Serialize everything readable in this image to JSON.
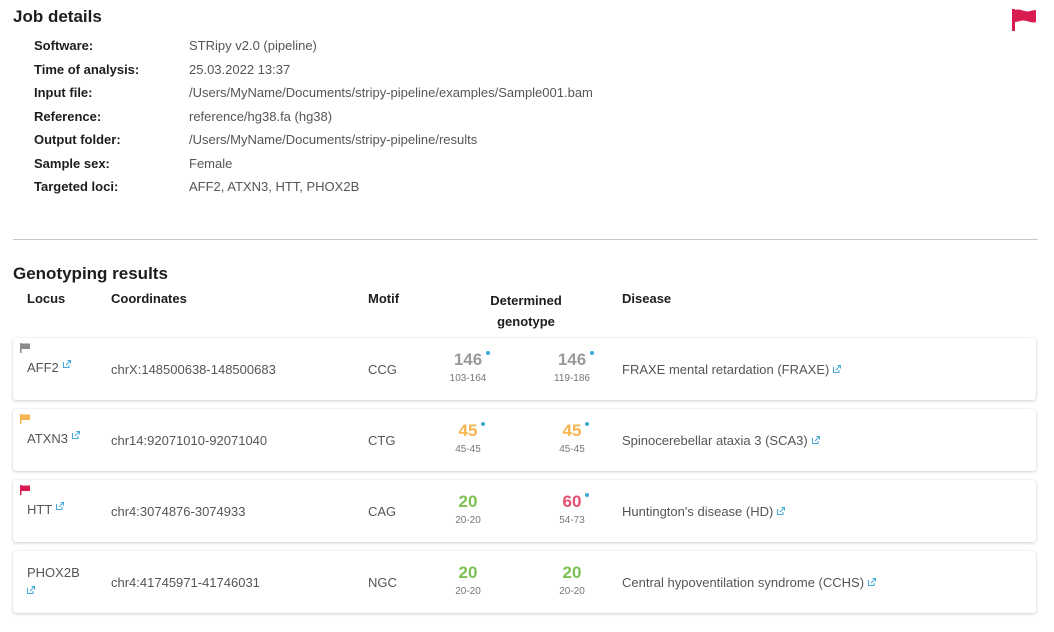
{
  "job_details": {
    "title": "Job details",
    "rows": [
      {
        "label": "Software:",
        "value": "STRipy v2.0 (pipeline)"
      },
      {
        "label": "Time of analysis:",
        "value": "25.03.2022 13:37"
      },
      {
        "label": "Input file:",
        "value": "/Users/MyName/Documents/stripy-pipeline/examples/Sample001.bam"
      },
      {
        "label": "Reference:",
        "value": "reference/hg38.fa (hg38)"
      },
      {
        "label": "Output folder:",
        "value": "/Users/MyName/Documents/stripy-pipeline/results"
      },
      {
        "label": "Sample sex:",
        "value": "Female"
      },
      {
        "label": "Targeted loci:",
        "value": "AFF2, ATXN3, HTT, PHOX2B"
      }
    ]
  },
  "genotyping": {
    "title": "Genotyping results",
    "headers": {
      "locus": "Locus",
      "coordinates": "Coordinates",
      "motif": "Motif",
      "genotype_line1": "Determined",
      "genotype_line2": "genotype",
      "disease": "Disease"
    },
    "rows": [
      {
        "locus": "AFF2",
        "coordinates": "chrX:148500638-148500683",
        "motif": "CCG",
        "allele1": "146",
        "range1": "103-164",
        "allele2": "146",
        "range2": "119-186",
        "disease": "FRAXE mental retardation (FRAXE)"
      },
      {
        "locus": "ATXN3",
        "coordinates": "chr14:92071010-92071040",
        "motif": "CTG",
        "allele1": "45",
        "range1": "45-45",
        "allele2": "45",
        "range2": "45-45",
        "disease": "Spinocerebellar ataxia 3 (SCA3)"
      },
      {
        "locus": "HTT",
        "coordinates": "chr4:3074876-3074933",
        "motif": "CAG",
        "allele1": "20",
        "range1": "20-20",
        "allele2": "60",
        "range2": "54-73",
        "disease": "Huntington's disease (HD)"
      },
      {
        "locus": "PHOX2B",
        "coordinates": "chr4:41745971-41746031",
        "motif": "NGC",
        "allele1": "20",
        "range1": "20-20",
        "allele2": "20",
        "range2": "20-20",
        "disease": "Central hypoventilation syndrome (CCHS)"
      }
    ]
  },
  "colors": {
    "flag_red": "#d81b50",
    "flag_orange": "#f7b550",
    "flag_gray": "#8a8a8a",
    "allele_gray": "#9a9a9a",
    "allele_orange": "#f7b550",
    "allele_green": "#7cc152",
    "allele_red": "#e2506e",
    "link_dot": "#3fa9d8"
  },
  "icons": [
    "flag-icon",
    "external-link-icon",
    "info-dot-icon"
  ]
}
